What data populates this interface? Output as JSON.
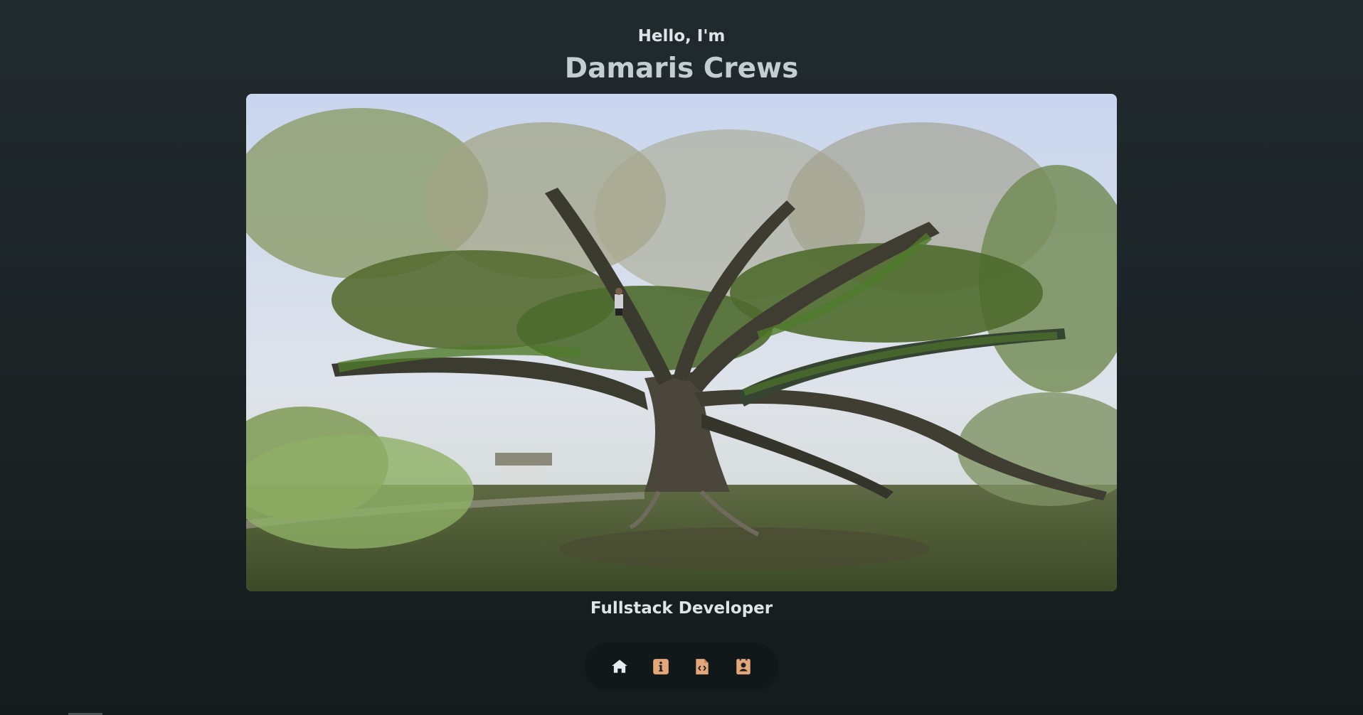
{
  "header": {
    "greeting": "Hello, I'm",
    "name": "Damaris Crews"
  },
  "hero": {
    "image_description_icon": "tree-photo"
  },
  "subtitle": "Fullstack Developer",
  "nav": {
    "items": [
      {
        "icon": "home-icon",
        "color": "#e6ecef"
      },
      {
        "icon": "info-icon",
        "color": "#e3a77a"
      },
      {
        "icon": "code-file-icon",
        "color": "#e3a77a"
      },
      {
        "icon": "contact-card-icon",
        "color": "#e3a77a"
      }
    ]
  },
  "colors": {
    "background": "#1e2629",
    "accent": "#e3a77a",
    "dock": "#11181a"
  }
}
